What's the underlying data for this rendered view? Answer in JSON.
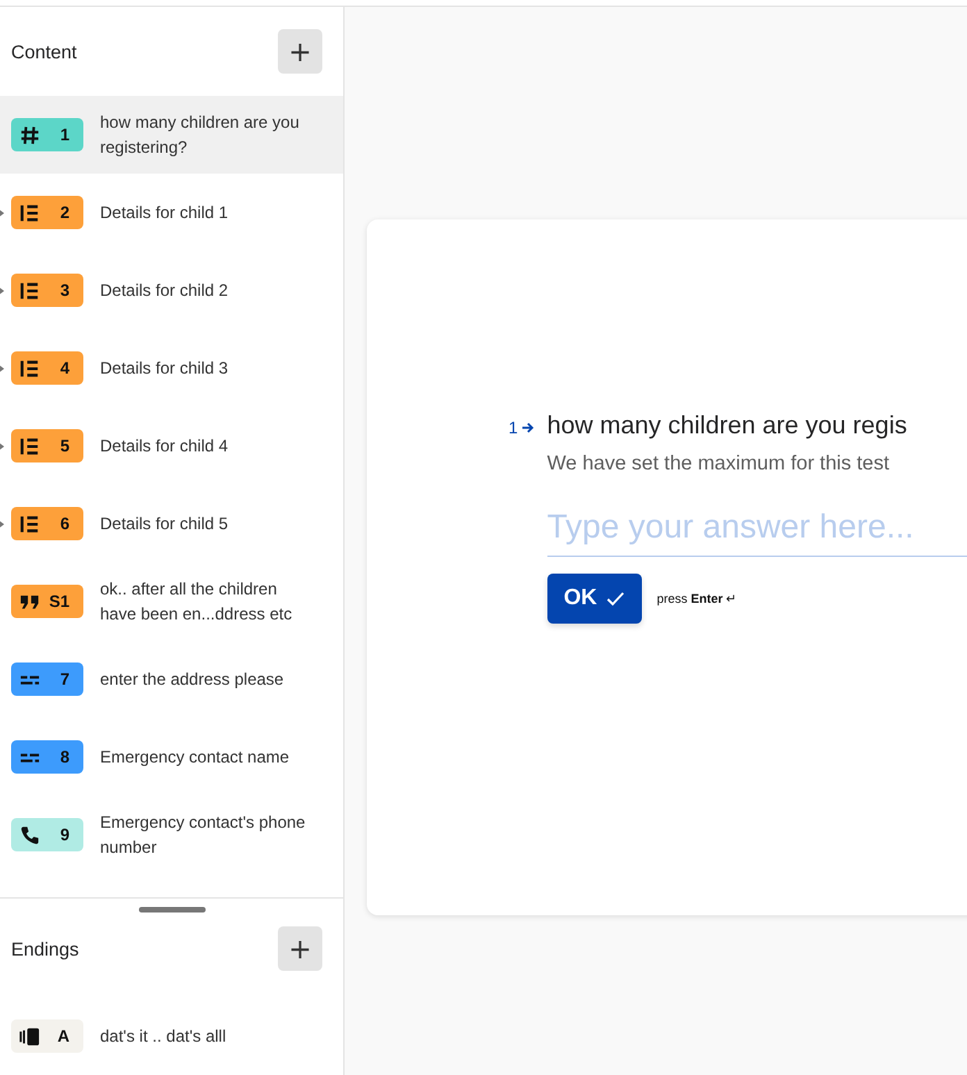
{
  "sidebar": {
    "content_title": "Content",
    "add_button": "+",
    "questions": [
      {
        "kind": "number",
        "number": "1",
        "color": "#5cd6c8",
        "text": "how many children are you registering?",
        "selected": true
      },
      {
        "kind": "group",
        "number": "2",
        "color": "#fda03a",
        "text": "Details for child 1",
        "selected": false
      },
      {
        "kind": "group",
        "number": "3",
        "color": "#fda03a",
        "text": "Details for child 2",
        "selected": false
      },
      {
        "kind": "group",
        "number": "4",
        "color": "#fda03a",
        "text": "Details for child 3",
        "selected": false
      },
      {
        "kind": "group",
        "number": "5",
        "color": "#fda03a",
        "text": "Details for child 4",
        "selected": false
      },
      {
        "kind": "group",
        "number": "6",
        "color": "#fda03a",
        "text": "Details for child 5",
        "selected": false
      },
      {
        "kind": "statement",
        "number": "S1",
        "color": "#fda03a",
        "text": "ok.. after all the children have been en...ddress etc",
        "selected": false
      },
      {
        "kind": "short_text",
        "number": "7",
        "color": "#3d9bfc",
        "text": "enter the address please",
        "selected": false
      },
      {
        "kind": "short_text",
        "number": "8",
        "color": "#3d9bfc",
        "text": "Emergency contact name",
        "selected": false
      },
      {
        "kind": "phone",
        "number": "9",
        "color": "#b0ebe4",
        "text": "Emergency contact's phone number",
        "selected": false
      }
    ],
    "endings_title": "Endings",
    "endings_add_button": "+",
    "endings": [
      {
        "kind": "ending",
        "number": "A",
        "color": "#f4f2ed",
        "text": "dat's it .. dat's alll",
        "selected": false
      }
    ]
  },
  "preview": {
    "question_number": "1",
    "question": "how many children are you regis",
    "description": "We have set the maximum for this test",
    "placeholder": "Type your answer here...",
    "ok_button": "OK",
    "hint": "press **Enter** ↵"
  }
}
